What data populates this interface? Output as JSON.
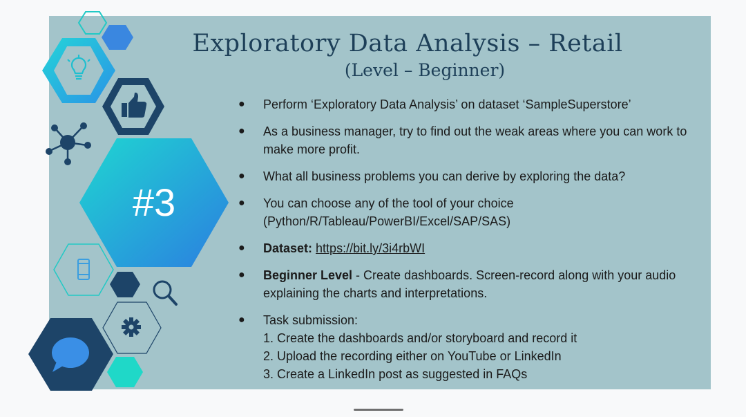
{
  "slide": {
    "title": "Exploratory Data Analysis – Retail",
    "subtitle": "(Level – Beginner)",
    "badge": "#3",
    "bullets": [
      {
        "text": "Perform ‘Exploratory Data Analysis’ on dataset  ‘SampleSuperstore’"
      },
      {
        "text": "As a business manager, try to find out the weak areas where you can work to make more profit."
      },
      {
        "text": "What all business problems you can derive by exploring the  data?"
      },
      {
        "text": "You can choose any of the tool of your choice (Python/R/Tableau/PowerBI/Excel/SAP/SAS)"
      },
      {
        "label": "Dataset:",
        "link": "https://bit.ly/3i4rbWI"
      },
      {
        "label": "Beginner Level",
        "text": " - Create dashboards. Screen-record along with your audio explaining the charts and interpretations."
      },
      {
        "text": "Task submission:",
        "lines": [
          "1. Create the dashboards and/or storyboard and record it",
          "2. Upload the recording either on YouTube or LinkedIn",
          "3. Create a LinkedIn post as suggested in FAQs"
        ]
      }
    ]
  },
  "icons": [
    "lightbulb-icon",
    "thumbs-up-icon",
    "network-icon",
    "phone-icon",
    "search-icon",
    "gear-icon",
    "chat-bubble-icon"
  ],
  "colors": {
    "slide_bg": "#a3c4ca",
    "navy": "#1d4468",
    "teal": "#1fd0cf",
    "blue": "#3a87e0",
    "text": "#1d3f58"
  }
}
